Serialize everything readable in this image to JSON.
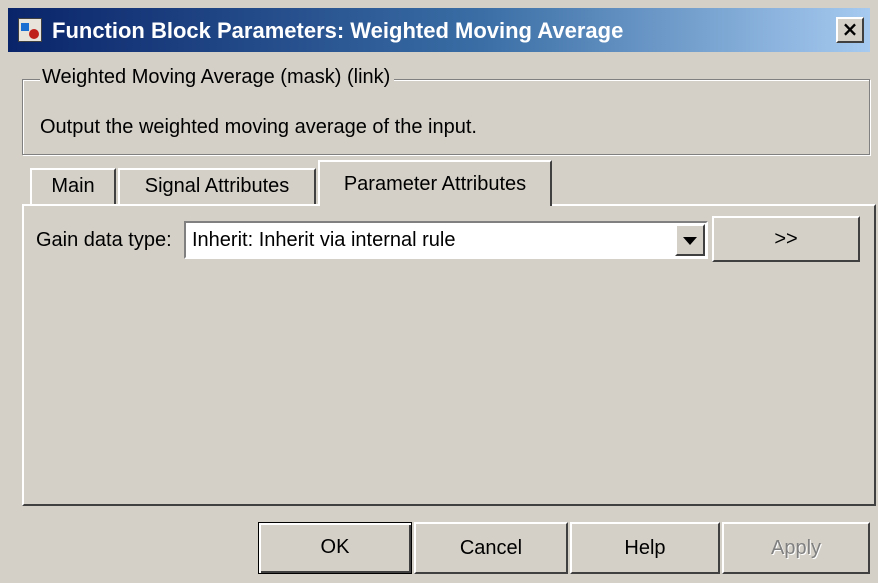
{
  "window": {
    "title": "Function Block Parameters: Weighted Moving Average",
    "close_glyph": "×",
    "icon": "simulink-block-icon"
  },
  "group": {
    "title": "Weighted Moving Average (mask) (link)",
    "description": "Output the weighted moving average of the input."
  },
  "tabs": [
    {
      "label": "Main",
      "selected": false
    },
    {
      "label": "Signal Attributes",
      "selected": false
    },
    {
      "label": "Parameter Attributes",
      "selected": true
    }
  ],
  "panel": {
    "gain_label": "Gain data type:",
    "gain_value": "Inherit: Inherit via internal rule",
    "expand_label": ">>"
  },
  "buttons": {
    "ok": "OK",
    "cancel": "Cancel",
    "help": "Help",
    "apply": "Apply",
    "apply_enabled": false
  },
  "colors": {
    "title_bar_start": "#0a246a",
    "title_bar_end": "#a6caf0",
    "face": "#d4d0c8"
  }
}
